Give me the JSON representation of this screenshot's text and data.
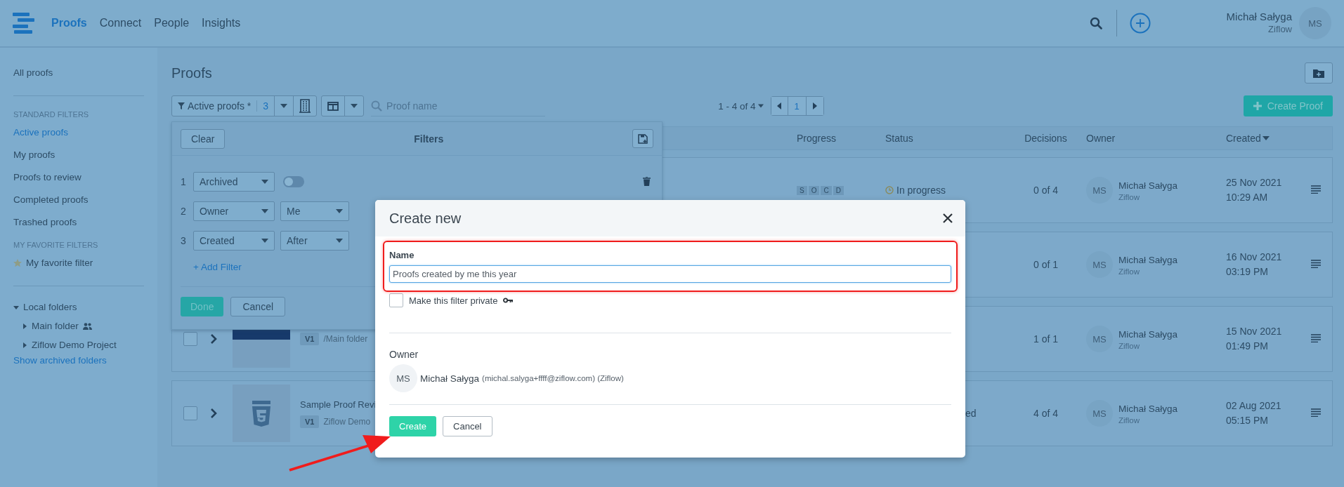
{
  "top_bar": {
    "nav": [
      {
        "label": "Proofs",
        "selected": true
      },
      {
        "label": "Connect",
        "selected": false
      },
      {
        "label": "People",
        "selected": false
      },
      {
        "label": "Insights",
        "selected": false
      }
    ],
    "user": {
      "name": "Michał Sałyga",
      "org": "Ziflow",
      "initials": "MS"
    }
  },
  "sidebar": {
    "top": [
      {
        "label": "All proofs",
        "selected": false
      }
    ],
    "sections": [
      {
        "heading": "STANDARD FILTERS",
        "items": [
          {
            "label": "Active proofs",
            "selected": true
          },
          {
            "label": "My proofs",
            "selected": false
          },
          {
            "label": "Proofs to review",
            "selected": false
          },
          {
            "label": "Completed proofs",
            "selected": false
          },
          {
            "label": "Trashed proofs",
            "selected": false
          }
        ]
      },
      {
        "heading": "MY FAVORITE FILTERS",
        "items": [
          {
            "label": "My favorite filter",
            "selected": false,
            "starred": true
          }
        ]
      }
    ],
    "folders": {
      "label": "Local folders",
      "expanded": true,
      "children": [
        {
          "label": "Main folder",
          "expanded": false,
          "shared": true
        },
        {
          "label": "Ziflow Demo Project",
          "expanded": false,
          "shared": false
        }
      ]
    },
    "archived_link": "Show archived folders"
  },
  "page": {
    "title": "Proofs"
  },
  "toolbar": {
    "filter_label": "Active proofs *",
    "filter_count": "3",
    "search_placeholder": "Proof name",
    "range": "1 - 4 of 4",
    "page": "1",
    "create_button": "Create Proof"
  },
  "table": {
    "columns": [
      {
        "label": "Progress",
        "sorted": false
      },
      {
        "label": "Status",
        "sorted": false
      },
      {
        "label": "Decisions",
        "sorted": false
      },
      {
        "label": "Owner",
        "sorted": false
      },
      {
        "label": "Created",
        "sorted": true
      }
    ],
    "rows": [
      {
        "progress": [
          "S",
          "O",
          "C",
          "D"
        ],
        "status": {
          "text": "In progress",
          "kind": "in_progress"
        },
        "decisions": "0 of 4",
        "owner": {
          "initials": "MS",
          "name": "Michał Sałyga",
          "org": "Ziflow"
        },
        "created": [
          "25 Nov 2021",
          "10:29 AM"
        ]
      },
      {
        "decisions": "0 of 1",
        "owner": {
          "initials": "MS",
          "name": "Michał Sałyga",
          "org": "Ziflow"
        },
        "created": [
          "16 Nov 2021",
          "03:19 PM"
        ]
      },
      {
        "checked": false,
        "thumbnail": {
          "kind": "image"
        },
        "version": "V1",
        "folder": "/Main folder",
        "decisions": "1 of 1",
        "owner": {
          "initials": "MS",
          "name": "Michał Sałyga",
          "org": "Ziflow"
        },
        "created": [
          "15 Nov 2021",
          "01:49 PM"
        ]
      },
      {
        "checked": false,
        "thumbnail": {
          "kind": "html"
        },
        "title": "Sample Proof Revi",
        "version": "V1",
        "folder": "Ziflow Demo",
        "status": {
          "text": "ed",
          "kind": "clipped"
        },
        "decisions": "4 of 4",
        "owner": {
          "initials": "MS",
          "name": "Michał Sałyga",
          "org": "Ziflow"
        },
        "created": [
          "02 Aug 2021",
          "05:15 PM"
        ]
      }
    ]
  },
  "filters_panel": {
    "clear": "Clear",
    "title": "Filters",
    "rows": [
      {
        "number": "1",
        "field": "Archived",
        "kind": "toggle",
        "on": false,
        "deletable": true
      },
      {
        "number": "2",
        "field": "Owner",
        "kind": "select",
        "value": "Me"
      },
      {
        "number": "3",
        "field": "Created",
        "kind": "select",
        "value": "After"
      }
    ],
    "add": "+ Add Filter",
    "done": "Done",
    "cancel": "Cancel"
  },
  "modal": {
    "title": "Create new",
    "name_label": "Name",
    "name_value": "Proofs created by me this year",
    "private_label": "Make this filter private",
    "private_checked": false,
    "owner_label": "Owner",
    "owner": {
      "initials": "MS",
      "name": "Michał Sałyga",
      "detail": "(michal.salyga+ffff@ziflow.com) (Ziflow)"
    },
    "create": "Create",
    "cancel": "Cancel"
  }
}
